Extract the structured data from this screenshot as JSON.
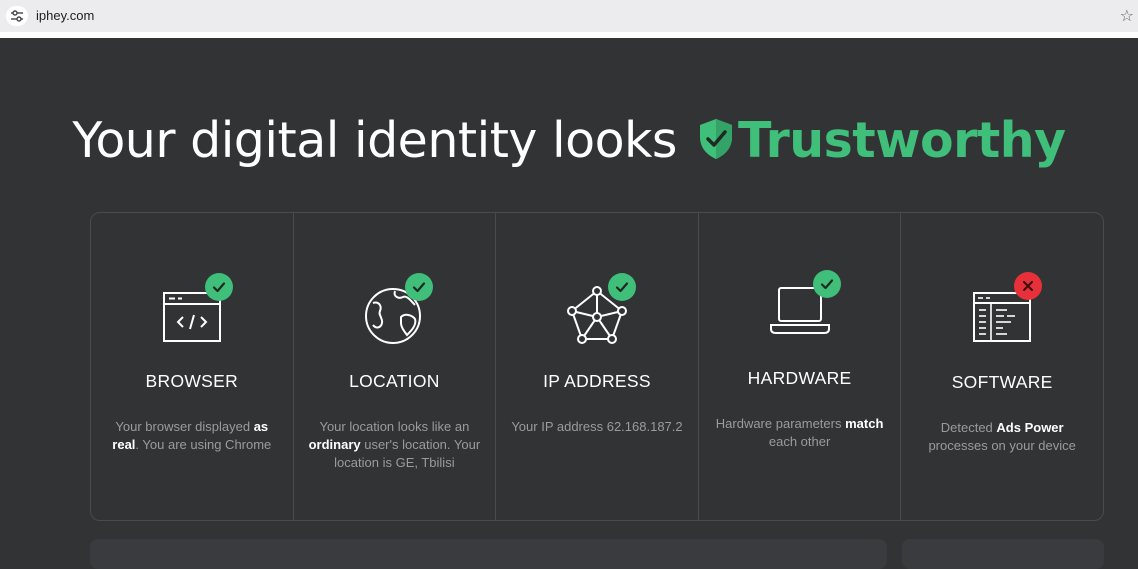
{
  "browser": {
    "url": "iphey.com",
    "site_info_icon": "tune-icon",
    "bookmark_icon": "star-icon"
  },
  "headline": {
    "prefix": "Your digital identity looks",
    "verdict": "Trustworthy",
    "verdict_color": "#3fbf7a",
    "shield_icon": "shield-check-icon"
  },
  "cards": [
    {
      "title": "BROWSER",
      "status": "ok",
      "icon": "browser-code-icon",
      "desc": [
        {
          "text": "Your browser displayed ",
          "bold": false
        },
        {
          "text": "as real",
          "bold": true
        },
        {
          "text": ". You are using Chrome",
          "bold": false
        }
      ]
    },
    {
      "title": "LOCATION",
      "status": "ok",
      "icon": "globe-icon",
      "desc": [
        {
          "text": "Your location looks like an ",
          "bold": false
        },
        {
          "text": "ordinary",
          "bold": true
        },
        {
          "text": " user's location. Your location is GE, Tbilisi",
          "bold": false
        }
      ]
    },
    {
      "title": "IP ADDRESS",
      "status": "ok",
      "icon": "network-icon",
      "desc": [
        {
          "text": "Your IP address 62.168.187.2",
          "bold": false
        }
      ]
    },
    {
      "title": "HARDWARE",
      "status": "ok",
      "icon": "laptop-icon",
      "desc": [
        {
          "text": "Hardware parameters ",
          "bold": false
        },
        {
          "text": "match",
          "bold": true
        },
        {
          "text": " each other",
          "bold": false
        }
      ]
    },
    {
      "title": "SOFTWARE",
      "status": "bad",
      "icon": "software-window-icon",
      "desc": [
        {
          "text": "Detected ",
          "bold": false
        },
        {
          "text": "Ads Power",
          "bold": true
        },
        {
          "text": " processes on your device",
          "bold": false
        }
      ]
    }
  ],
  "colors": {
    "ok": "#3fbf7a",
    "bad": "#e8303a",
    "background": "#323335"
  }
}
